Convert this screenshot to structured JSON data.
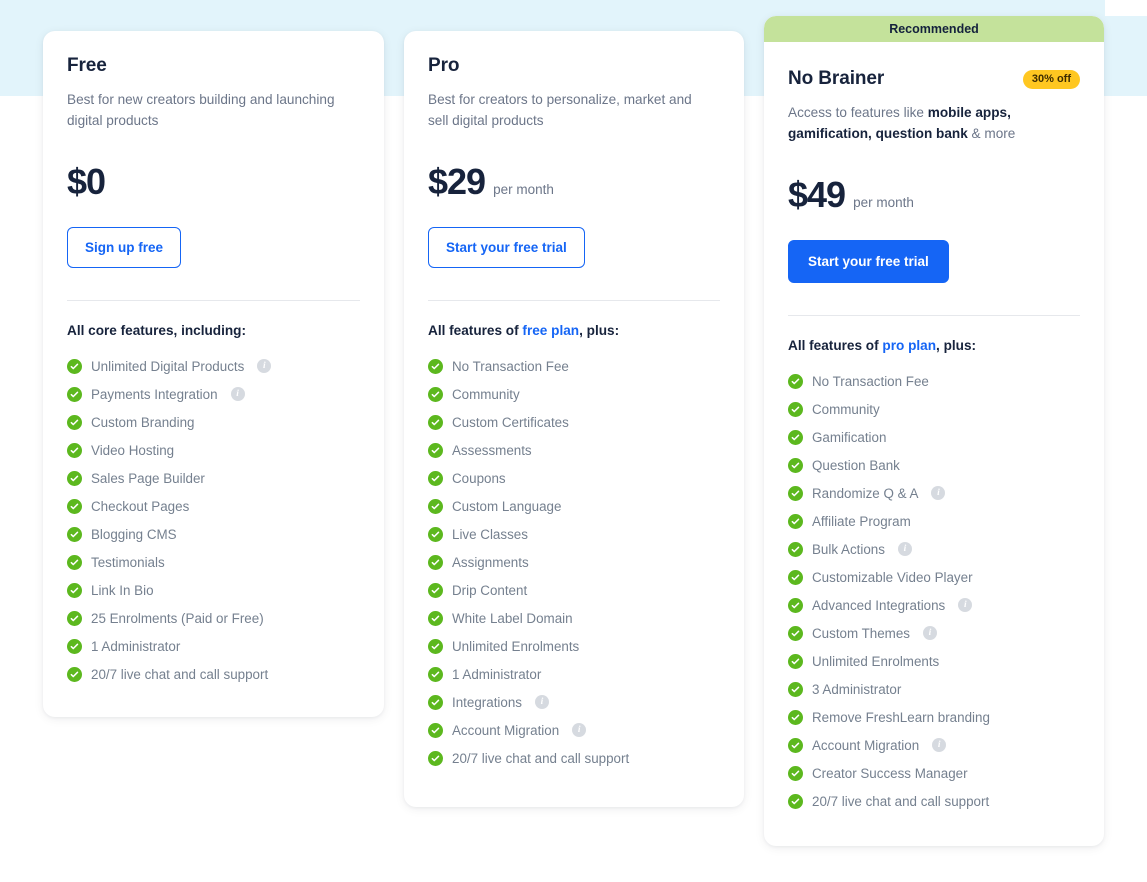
{
  "theme": {
    "band_color": "#e2f4fb",
    "accent_blue": "#1565f5",
    "check_green": "#5cb81e",
    "ribbon_green": "#c4e29b",
    "badge_yellow": "#ffc721"
  },
  "plans": [
    {
      "name": "Free",
      "description": "Best for new creators building and launching digital products",
      "price": "$0",
      "period": "",
      "cta": "Sign up free",
      "cta_style": "outline",
      "features_heading_prefix": "All core features, including:",
      "features_heading_link": "",
      "features_heading_suffix": "",
      "features": [
        {
          "label": "Unlimited Digital Products",
          "info": true
        },
        {
          "label": "Payments Integration",
          "info": true
        },
        {
          "label": "Custom Branding",
          "info": false
        },
        {
          "label": "Video Hosting",
          "info": false
        },
        {
          "label": "Sales Page Builder",
          "info": false
        },
        {
          "label": "Checkout Pages",
          "info": false
        },
        {
          "label": "Blogging CMS",
          "info": false
        },
        {
          "label": "Testimonials",
          "info": false
        },
        {
          "label": "Link In Bio",
          "info": false
        },
        {
          "label": "25 Enrolments (Paid or Free)",
          "info": false
        },
        {
          "label": "1 Administrator",
          "info": false
        },
        {
          "label": "20/7 live chat and call support",
          "info": false
        }
      ]
    },
    {
      "name": "Pro",
      "description": "Best for creators to personalize, market and sell digital products",
      "price": "$29",
      "period": "per month",
      "cta": "Start your free trial",
      "cta_style": "outline",
      "features_heading_prefix": "All features of ",
      "features_heading_link": "free plan",
      "features_heading_suffix": ", plus:",
      "features": [
        {
          "label": "No Transaction Fee",
          "info": false
        },
        {
          "label": "Community",
          "info": false
        },
        {
          "label": "Custom Certificates",
          "info": false
        },
        {
          "label": "Assessments",
          "info": false
        },
        {
          "label": "Coupons",
          "info": false
        },
        {
          "label": "Custom Language",
          "info": false
        },
        {
          "label": "Live Classes",
          "info": false
        },
        {
          "label": "Assignments",
          "info": false
        },
        {
          "label": "Drip Content",
          "info": false
        },
        {
          "label": "White Label Domain",
          "info": false
        },
        {
          "label": "Unlimited Enrolments",
          "info": false
        },
        {
          "label": "1 Administrator",
          "info": false
        },
        {
          "label": "Integrations",
          "info": true
        },
        {
          "label": "Account Migration",
          "info": true
        },
        {
          "label": "20/7 live chat and call support",
          "info": false
        }
      ]
    },
    {
      "name": "No Brainer",
      "ribbon": "Recommended",
      "badge": "30% off",
      "description_parts": [
        {
          "text": "Access to features like ",
          "bold": false
        },
        {
          "text": "mobile apps, gamification, question bank",
          "bold": true
        },
        {
          "text": " & more",
          "bold": false
        }
      ],
      "price": "$49",
      "period": "per month",
      "cta": "Start your free trial",
      "cta_style": "solid",
      "features_heading_prefix": "All features of ",
      "features_heading_link": "pro plan",
      "features_heading_suffix": ", plus:",
      "features": [
        {
          "label": "No Transaction Fee",
          "info": false
        },
        {
          "label": "Community",
          "info": false
        },
        {
          "label": "Gamification",
          "info": false
        },
        {
          "label": "Question Bank",
          "info": false
        },
        {
          "label": "Randomize Q & A",
          "info": true
        },
        {
          "label": "Affiliate Program",
          "info": false
        },
        {
          "label": "Bulk Actions",
          "info": true
        },
        {
          "label": "Customizable Video Player",
          "info": false
        },
        {
          "label": "Advanced Integrations",
          "info": true
        },
        {
          "label": "Custom Themes",
          "info": true
        },
        {
          "label": "Unlimited Enrolments",
          "info": false
        },
        {
          "label": "3 Administrator",
          "info": false
        },
        {
          "label": "Remove FreshLearn branding",
          "info": false
        },
        {
          "label": "Account Migration",
          "info": true
        },
        {
          "label": "Creator Success Manager",
          "info": false
        },
        {
          "label": "20/7 live chat and call support",
          "info": false
        }
      ]
    }
  ]
}
